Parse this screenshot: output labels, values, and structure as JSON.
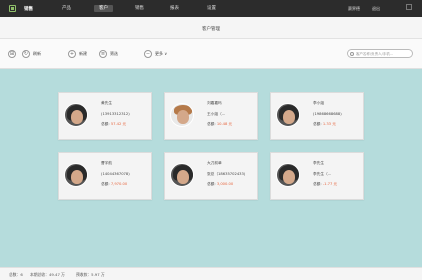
{
  "app": {
    "title": "销售"
  },
  "nav": [
    {
      "label": "产品",
      "active": false
    },
    {
      "label": "客户",
      "active": true
    },
    {
      "label": "销售",
      "active": false
    },
    {
      "label": "报表",
      "active": false
    },
    {
      "label": "设置",
      "active": false
    }
  ],
  "top_right": {
    "user": "赛界德",
    "logout": "退出"
  },
  "page_title": "客户管理",
  "toolbar": {
    "refresh": "刷新",
    "add": "新建",
    "filter": "筛选",
    "more": "更多 ∨",
    "search_placeholder": "客户名称/负责人/手机..."
  },
  "customers": [
    {
      "name": "黄先生",
      "line2": "(13913312312)",
      "amount_label": "总额:",
      "amount": "57.42 元",
      "avatar": "dark"
    },
    {
      "name": "刘嘉嘉玛",
      "line2": "王小姐（...",
      "amount_label": "总额:",
      "amount": "10.48 元",
      "avatar": "light"
    },
    {
      "name": "李小姐",
      "line2": "(19868668688)",
      "amount_label": "总额:",
      "amount": "1.33 元",
      "avatar": "dark"
    },
    {
      "name": "曹宇航",
      "line2": "(14044367078)",
      "amount_label": "总额:",
      "amount": "7,970.00",
      "avatar": "dark"
    },
    {
      "name": "大刀前辈",
      "line2": "张总（18635702433)",
      "amount_label": "总额:",
      "amount": "3,000.00",
      "avatar": "dark"
    },
    {
      "name": "李先生",
      "line2": "李先生（...",
      "amount_label": "总额:",
      "amount": "-1.77 元",
      "avatar": "dark"
    }
  ],
  "status": {
    "count": "总数：6",
    "month_sales": "本期总收：49.47 万",
    "forecast": "预收款：5.97 万"
  },
  "colors": {
    "topbar": "#2c2c2c",
    "background": "#b5dcdc",
    "amount": "#e6643c"
  }
}
